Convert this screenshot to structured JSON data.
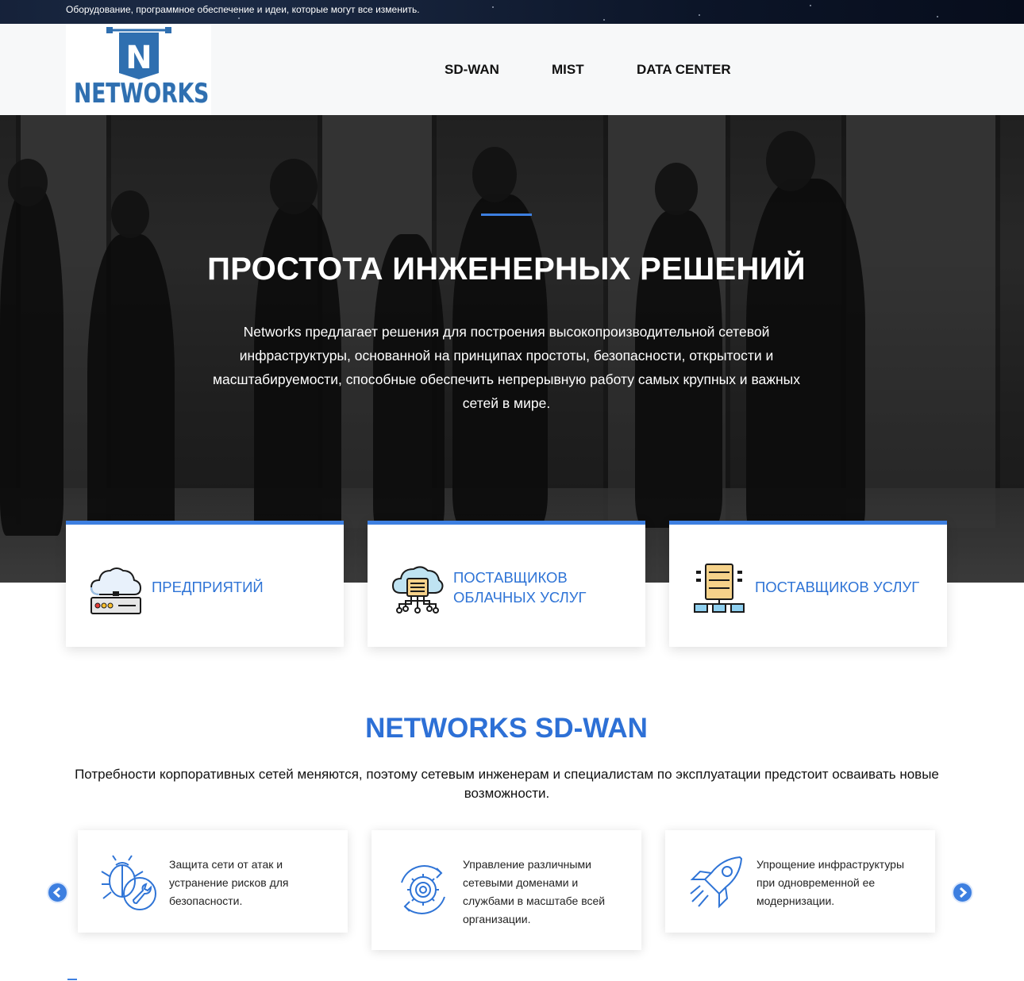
{
  "topbar": {
    "tagline": "Оборудование, программное обеспечение и идеи, которые могут все изменить."
  },
  "header": {
    "logo_letter": "N",
    "logo_text": "NETWORKS",
    "nav": [
      {
        "label": "SD-WAN"
      },
      {
        "label": "MIST"
      },
      {
        "label": "DATA CENTER"
      }
    ]
  },
  "hero": {
    "title": "ПРОСТОТА ИНЖЕНЕРНЫХ РЕШЕНИЙ",
    "description": "Networks предлагает решения для построения высокопроизводительной сетевой инфраструктуры, основанной на принципах простоты, безопасности, открытости и масштабируемости, способные обеспечить непрерывную работу самых крупных и важных сетей в мире."
  },
  "features": [
    {
      "label": "ПРЕДПРИЯТИЙ",
      "icon": "cloud-server-icon"
    },
    {
      "label": "ПОСТАВЩИКОВ ОБЛАЧНЫХ УСЛУГ",
      "icon": "cloud-network-icon"
    },
    {
      "label": "ПОСТАВЩИКОВ УСЛУГ",
      "icon": "server-rack-icon"
    }
  ],
  "sdwan": {
    "title": "NETWORKS SD-WAN",
    "description": "Потребности корпоративных сетей меняются, поэтому сетевым инженерам и специалистам по эксплуатации предстоит осваивать новые возможности.",
    "cards": [
      {
        "text": "Защита сети от атак и устранение рисков для безопасности.",
        "icon": "bug-shield-icon"
      },
      {
        "text": "Управление различными сетевыми доменами и службами в масштабе всей организации.",
        "icon": "gear-cycle-icon"
      },
      {
        "text": "Упрощение инфраструктуры при одновременной ее модернизации.",
        "icon": "rocket-icon"
      }
    ]
  },
  "colors": {
    "accent": "#3d7fe0",
    "title_blue": "#2d70d6",
    "header_bg": "#f7f8f9",
    "topbar_bg": "#0c1528"
  }
}
